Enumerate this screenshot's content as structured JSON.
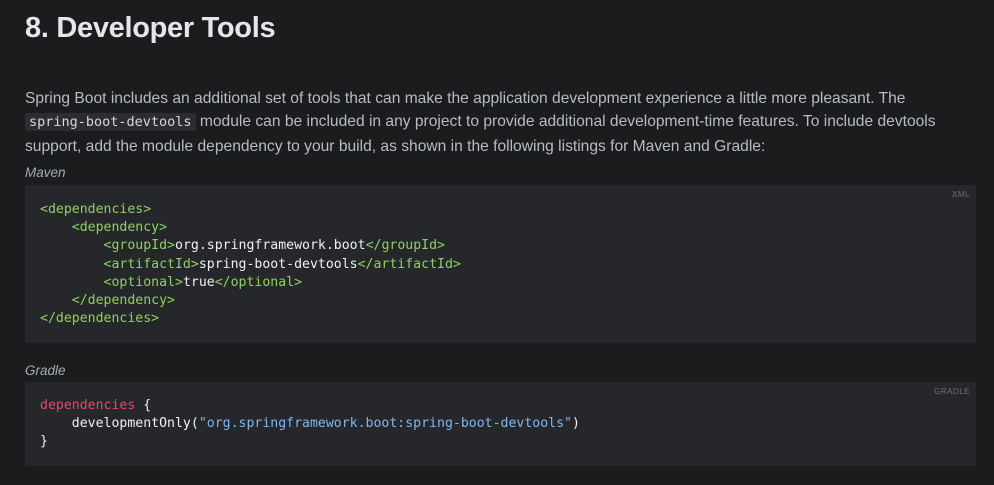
{
  "section": {
    "title": "8. Developer Tools",
    "intro": {
      "part1": "Spring Boot includes an additional set of tools that can make the application development experience a little more pleasant. The ",
      "code": "spring-boot-devtools",
      "part2": " module can be included in any project to provide additional development-time features. To include devtools support, add the module dependency to your build, as shown in the following listings for Maven and Gradle:"
    }
  },
  "maven": {
    "title": "Maven",
    "lang": "XML",
    "lines": [
      {
        "indent": "",
        "open": "<dependencies>",
        "text": "",
        "close": ""
      },
      {
        "indent": "    ",
        "open": "<dependency>",
        "text": "",
        "close": ""
      },
      {
        "indent": "        ",
        "open": "<groupId>",
        "text": "org.springframework.boot",
        "close": "</groupId>"
      },
      {
        "indent": "        ",
        "open": "<artifactId>",
        "text": "spring-boot-devtools",
        "close": "</artifactId>"
      },
      {
        "indent": "        ",
        "open": "<optional>",
        "text": "true",
        "close": "</optional>"
      },
      {
        "indent": "    ",
        "open": "</dependency>",
        "text": "",
        "close": ""
      },
      {
        "indent": "",
        "open": "</dependencies>",
        "text": "",
        "close": ""
      }
    ]
  },
  "gradle": {
    "title": "Gradle",
    "lang": "GRADLE",
    "line1_keyword": "dependencies",
    "line1_rest": " {",
    "line2_indent": "    ",
    "line2_fn": "developmentOnly(",
    "line2_string": "\"org.springframework.boot:spring-boot-devtools\"",
    "line2_end": ")",
    "line3": "}"
  }
}
